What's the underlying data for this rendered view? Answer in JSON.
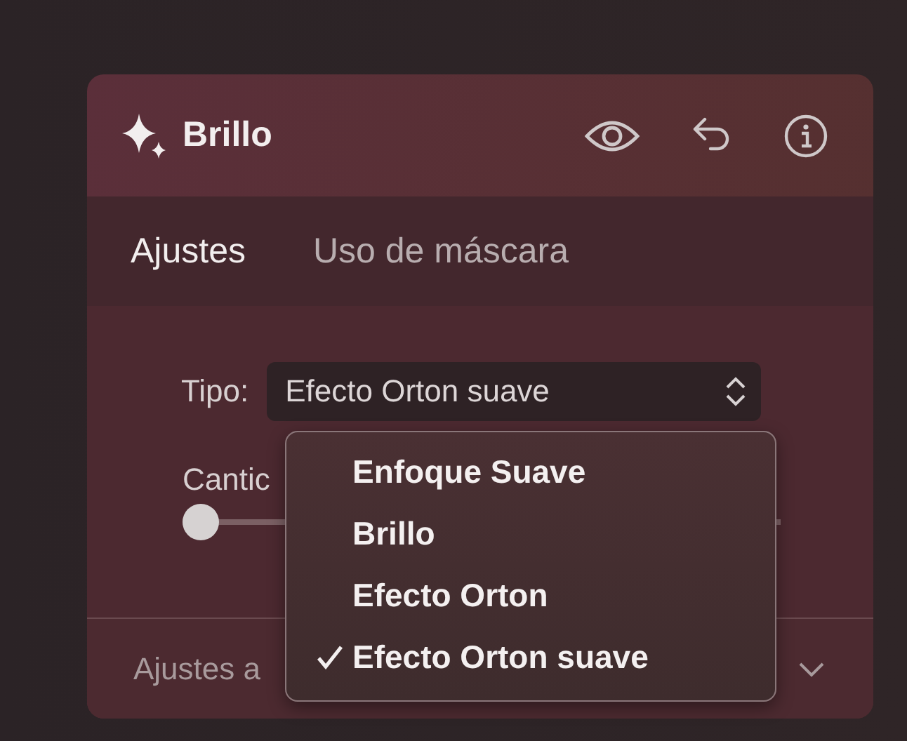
{
  "panel": {
    "title": "Brillo"
  },
  "tabs": [
    {
      "label": "Ajustes",
      "selected": true
    },
    {
      "label": "Uso de máscara",
      "selected": false
    }
  ],
  "type_field": {
    "label": "Tipo:",
    "value": "Efecto Orton suave"
  },
  "amount": {
    "label": "Cantic",
    "level": 0
  },
  "footer": {
    "label": "Ajustes a"
  },
  "menu": [
    {
      "label": "Enfoque Suave",
      "checked": false
    },
    {
      "label": "Brillo",
      "checked": false
    },
    {
      "label": "Efecto Orton",
      "checked": false
    },
    {
      "label": "Efecto Orton suave",
      "checked": true
    }
  ]
}
